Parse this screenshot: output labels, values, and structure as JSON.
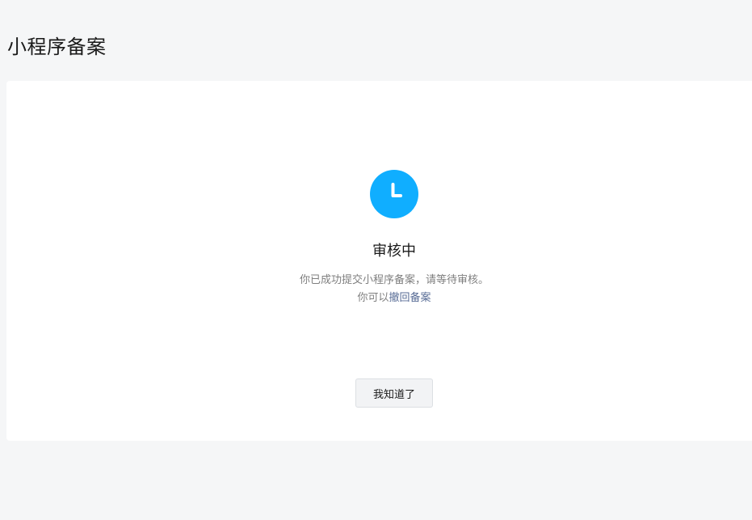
{
  "page": {
    "title": "小程序备案"
  },
  "status": {
    "icon": "clock-icon",
    "icon_color": "#10aeff",
    "title": "审核中",
    "description_line1": "你已成功提交小程序备案，请等待审核。",
    "description_line2_prefix": "你可以",
    "withdraw_link": "撤回备案"
  },
  "actions": {
    "ok_button": "我知道了"
  }
}
